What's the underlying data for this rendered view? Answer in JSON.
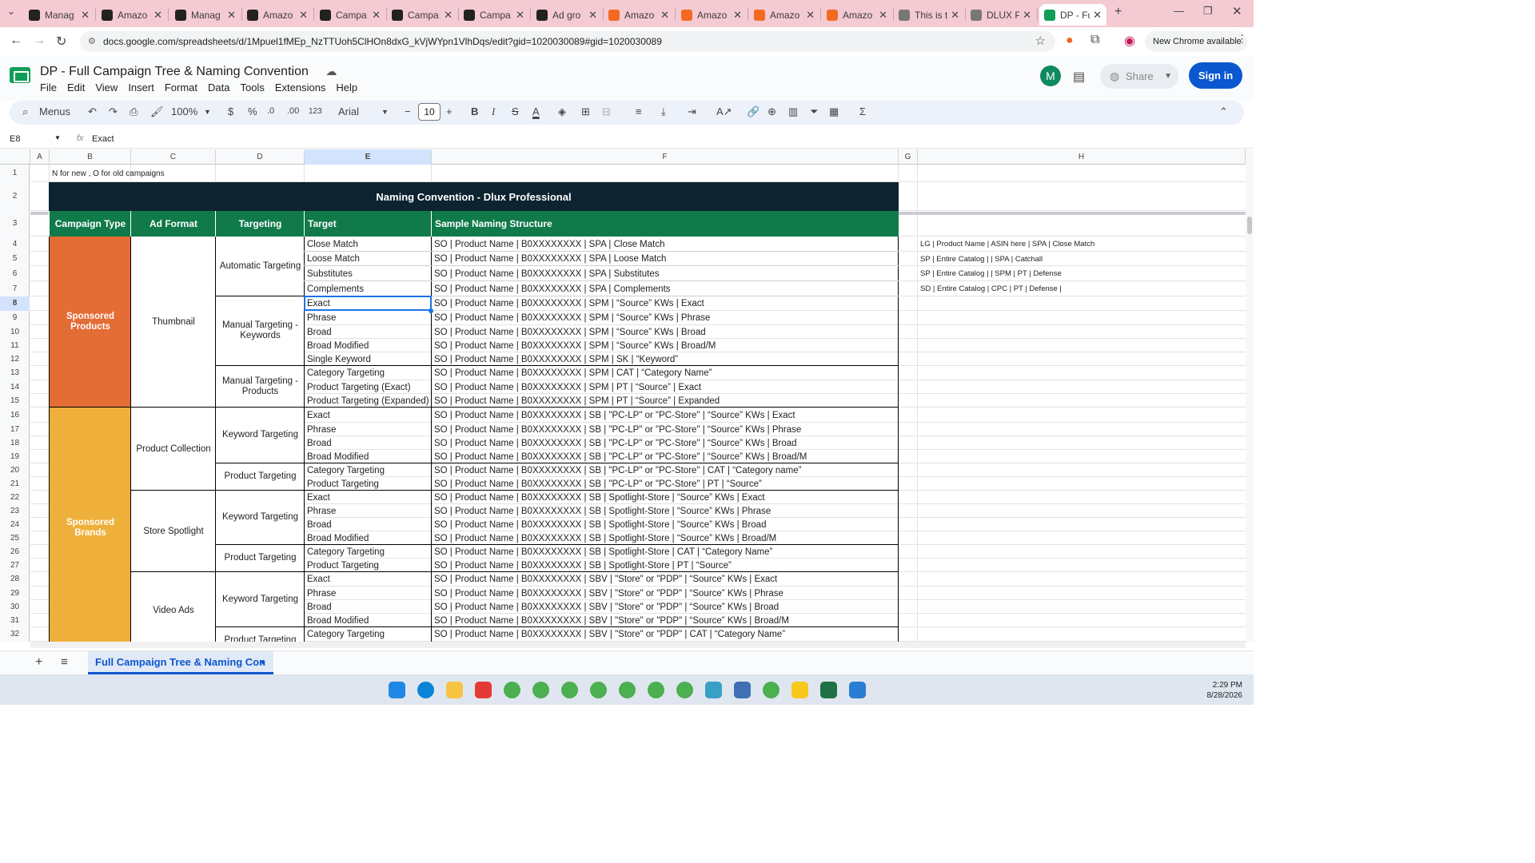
{
  "browser": {
    "tabs": [
      {
        "title": "Manag",
        "icon": "amazon-icon",
        "c": "#222"
      },
      {
        "title": "Amazo",
        "icon": "amazon-icon",
        "c": "#222"
      },
      {
        "title": "Manag",
        "icon": "amazon-icon",
        "c": "#222"
      },
      {
        "title": "Amazo",
        "icon": "amazon-icon",
        "c": "#222"
      },
      {
        "title": "Campa",
        "icon": "mail-icon",
        "c": "#222"
      },
      {
        "title": "Campa",
        "icon": "mail-icon",
        "c": "#222"
      },
      {
        "title": "Campa",
        "icon": "mail-icon",
        "c": "#222"
      },
      {
        "title": "Ad gro",
        "icon": "adgroup-icon",
        "c": "#222"
      },
      {
        "title": "Amazo",
        "icon": "amazon-orange-icon",
        "c": "#f26a21"
      },
      {
        "title": "Amazo",
        "icon": "amazon-orange-icon",
        "c": "#f26a21"
      },
      {
        "title": "Amazo",
        "icon": "amazon-orange-icon",
        "c": "#f26a21"
      },
      {
        "title": "Amazo",
        "icon": "amazon-orange-icon",
        "c": "#f26a21"
      },
      {
        "title": "This is t",
        "icon": "site-icon",
        "c": "#777"
      },
      {
        "title": "DLUX P",
        "icon": "site-icon",
        "c": "#777"
      },
      {
        "title": "DP - Fu",
        "icon": "sheets-icon",
        "c": "#0f9d58"
      }
    ],
    "url": "docs.google.com/spreadsheets/d/1Mpuel1fMEp_NzTTUoh5ClHOn8dxG_kVjWYpn1VlhDqs/edit?gid=1020030089#gid=1020030089",
    "update_label": "New Chrome available"
  },
  "doc": {
    "title": "DP - Full Campaign Tree & Naming Convention",
    "menus": [
      "File",
      "Edit",
      "View",
      "Insert",
      "Format",
      "Data",
      "Tools",
      "Extensions",
      "Help"
    ],
    "avatar": "M",
    "share": "Share",
    "sign_in": "Sign in"
  },
  "toolbar": {
    "menus_label": "Menus",
    "zoom": "100%",
    "currency": "$",
    "percent": "%",
    "dec_less": ".0",
    "dec_more": ".00",
    "number_format": "123",
    "font": "Arial",
    "font_size": "10"
  },
  "formula_bar": {
    "cell_ref": "E8",
    "fx": "fx",
    "value": "Exact"
  },
  "columns": [
    "A",
    "B",
    "C",
    "D",
    "E",
    "F",
    "G",
    "H"
  ],
  "rows": [
    "1",
    "2",
    "3",
    "4",
    "5",
    "6",
    "7",
    "8",
    "9",
    "10",
    "11",
    "12",
    "13",
    "14",
    "15",
    "16",
    "17",
    "18",
    "19",
    "20",
    "21",
    "22",
    "23",
    "24",
    "25",
    "26",
    "27",
    "28",
    "29",
    "30",
    "31",
    "32"
  ],
  "sheet": {
    "note": "N for new , O for old campaigns",
    "banner": "Naming Convention - Dlux Professional",
    "headers": [
      "Campaign Type",
      "Ad Format",
      "Targeting",
      "Target",
      "Sample Naming Structure"
    ],
    "campaign_types": [
      "Sponsored Products",
      "Sponsored Brands"
    ],
    "ad_formats": [
      "Thumbnail",
      "Product Collection",
      "Store Spotlight",
      "Video Ads"
    ],
    "targetings": [
      "Automatic Targeting",
      "Manual Targeting - Keywords",
      "Manual Targeting - Products",
      "Keyword Targeting",
      "Product Targeting",
      "Keyword Targeting",
      "Product Targeting",
      "Keyword Targeting",
      "Product Targeting"
    ],
    "targets": [
      "Close Match",
      "Loose Match",
      "Substitutes",
      "Complements",
      "Exact",
      "Phrase",
      "Broad",
      "Broad Modified",
      "Single Keyword",
      "Category Targeting",
      "Product Targeting (Exact)",
      "Product Targeting (Expanded)",
      "Exact",
      "Phrase",
      "Broad",
      "Broad Modified",
      "Category Targeting",
      "Product Targeting",
      "Exact",
      "Phrase",
      "Broad",
      "Broad Modified",
      "Category Targeting",
      "Product Targeting",
      "Exact",
      "Phrase",
      "Broad",
      "Broad Modified",
      "Category Targeting"
    ],
    "names": [
      "SO | Product Name | B0XXXXXXXX | SPA | Close Match",
      "SO | Product Name | B0XXXXXXXX | SPA | Loose Match",
      "SO | Product Name | B0XXXXXXXX | SPA | Substitutes",
      "SO | Product Name | B0XXXXXXXX | SPA | Complements",
      "SO | Product Name | B0XXXXXXXX | SPM | “Source” KWs | Exact",
      "SO | Product Name | B0XXXXXXXX | SPM | “Source” KWs | Phrase",
      "SO | Product Name | B0XXXXXXXX | SPM | “Source” KWs | Broad",
      "SO | Product Name | B0XXXXXXXX | SPM | “Source” KWs | Broad/M",
      "SO | Product Name | B0XXXXXXXX | SPM | SK | “Keyword”",
      "SO | Product Name | B0XXXXXXXX | SPM | CAT | “Category Name”",
      "SO | Product Name | B0XXXXXXXX | SPM | PT | “Source” | Exact",
      "SO | Product Name | B0XXXXXXXX | SPM | PT | “Source” | Expanded",
      "SO | Product Name | B0XXXXXXXX | SB | \"PC-LP\" or \"PC-Store\" | “Source” KWs | Exact",
      "SO | Product Name | B0XXXXXXXX | SB | \"PC-LP\" or \"PC-Store\" | “Source” KWs | Phrase",
      "SO | Product Name | B0XXXXXXXX | SB | \"PC-LP\" or \"PC-Store\" | “Source” KWs | Broad",
      "SO | Product Name | B0XXXXXXXX | SB | \"PC-LP\" or \"PC-Store\" | “Source” KWs | Broad/M",
      "SO | Product Name | B0XXXXXXXX | SB | \"PC-LP\" or \"PC-Store\" | CAT | “Category name”",
      "SO | Product Name | B0XXXXXXXX | SB | \"PC-LP\" or \"PC-Store\" | PT | “Source”",
      "SO | Product Name | B0XXXXXXXX | SB | Spotlight-Store | “Source” KWs | Exact",
      "SO | Product Name | B0XXXXXXXX | SB | Spotlight-Store | “Source” KWs | Phrase",
      "SO | Product Name | B0XXXXXXXX | SB | Spotlight-Store | “Source” KWs | Broad",
      "SO | Product Name | B0XXXXXXXX | SB | Spotlight-Store | “Source” KWs | Broad/M",
      "SO | Product Name | B0XXXXXXXX | SB | Spotlight-Store | CAT | “Category Name”",
      "SO | Product Name | B0XXXXXXXX | SB | Spotlight-Store | PT | “Source”",
      "SO | Product Name | B0XXXXXXXX | SBV | \"Store\" or \"PDP\" | “Source” KWs | Exact",
      "SO | Product Name | B0XXXXXXXX | SBV | \"Store\" or \"PDP\" | “Source” KWs | Phrase",
      "SO | Product Name | B0XXXXXXXX | SBV | \"Store\" or \"PDP\" | “Source” KWs | Broad",
      "SO | Product Name | B0XXXXXXXX | SBV | \"Store\" or \"PDP\" | “Source” KWs | Broad/M",
      "SO | Product Name | B0XXXXXXXX | SBV | \"Store\" or \"PDP\" | CAT | “Category Name”"
    ],
    "side_notes": [
      "LG | Product Name | ASIN here | SPA | Close Match",
      "SP | Entire Catalog |  | SPA | Catchall",
      "SP | Entire Catalog |  | SPM | PT | Defense",
      "SD | Entire Catalog | CPC | PT | Defense |"
    ],
    "partial_label": "Product Targeting"
  },
  "sheet_tab": "Full Campaign Tree & Naming Con",
  "clock": {
    "time": "2:29 PM",
    "date": "8/28/2026"
  },
  "colors": {
    "banner": "#0d2330",
    "header": "#107a4a",
    "sp": "#e46c35",
    "sb": "#eeb03a",
    "selection": "#1a73e8"
  }
}
